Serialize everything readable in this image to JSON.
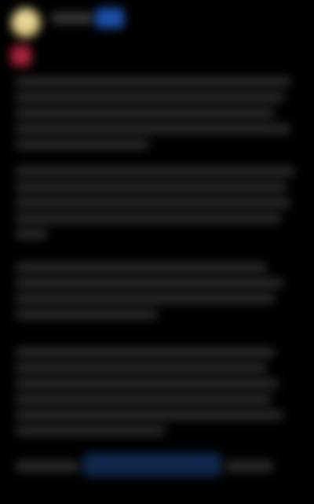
{
  "header": {
    "author_name": "",
    "follow_label": ""
  },
  "post": {
    "paragraphs": [
      {
        "text": ""
      },
      {
        "text": ""
      },
      {
        "text": ""
      },
      {
        "text": ""
      }
    ]
  },
  "footer": {
    "label": "",
    "link_text": ""
  },
  "colors": {
    "background": "#000000",
    "avatar": "#d8c27a",
    "accent_blue": "#1d4fa8",
    "reaction_red": "#a8243a",
    "link_bg": "#10284e"
  },
  "icons": {
    "avatar": "user-avatar",
    "reaction": "reaction-icon"
  }
}
